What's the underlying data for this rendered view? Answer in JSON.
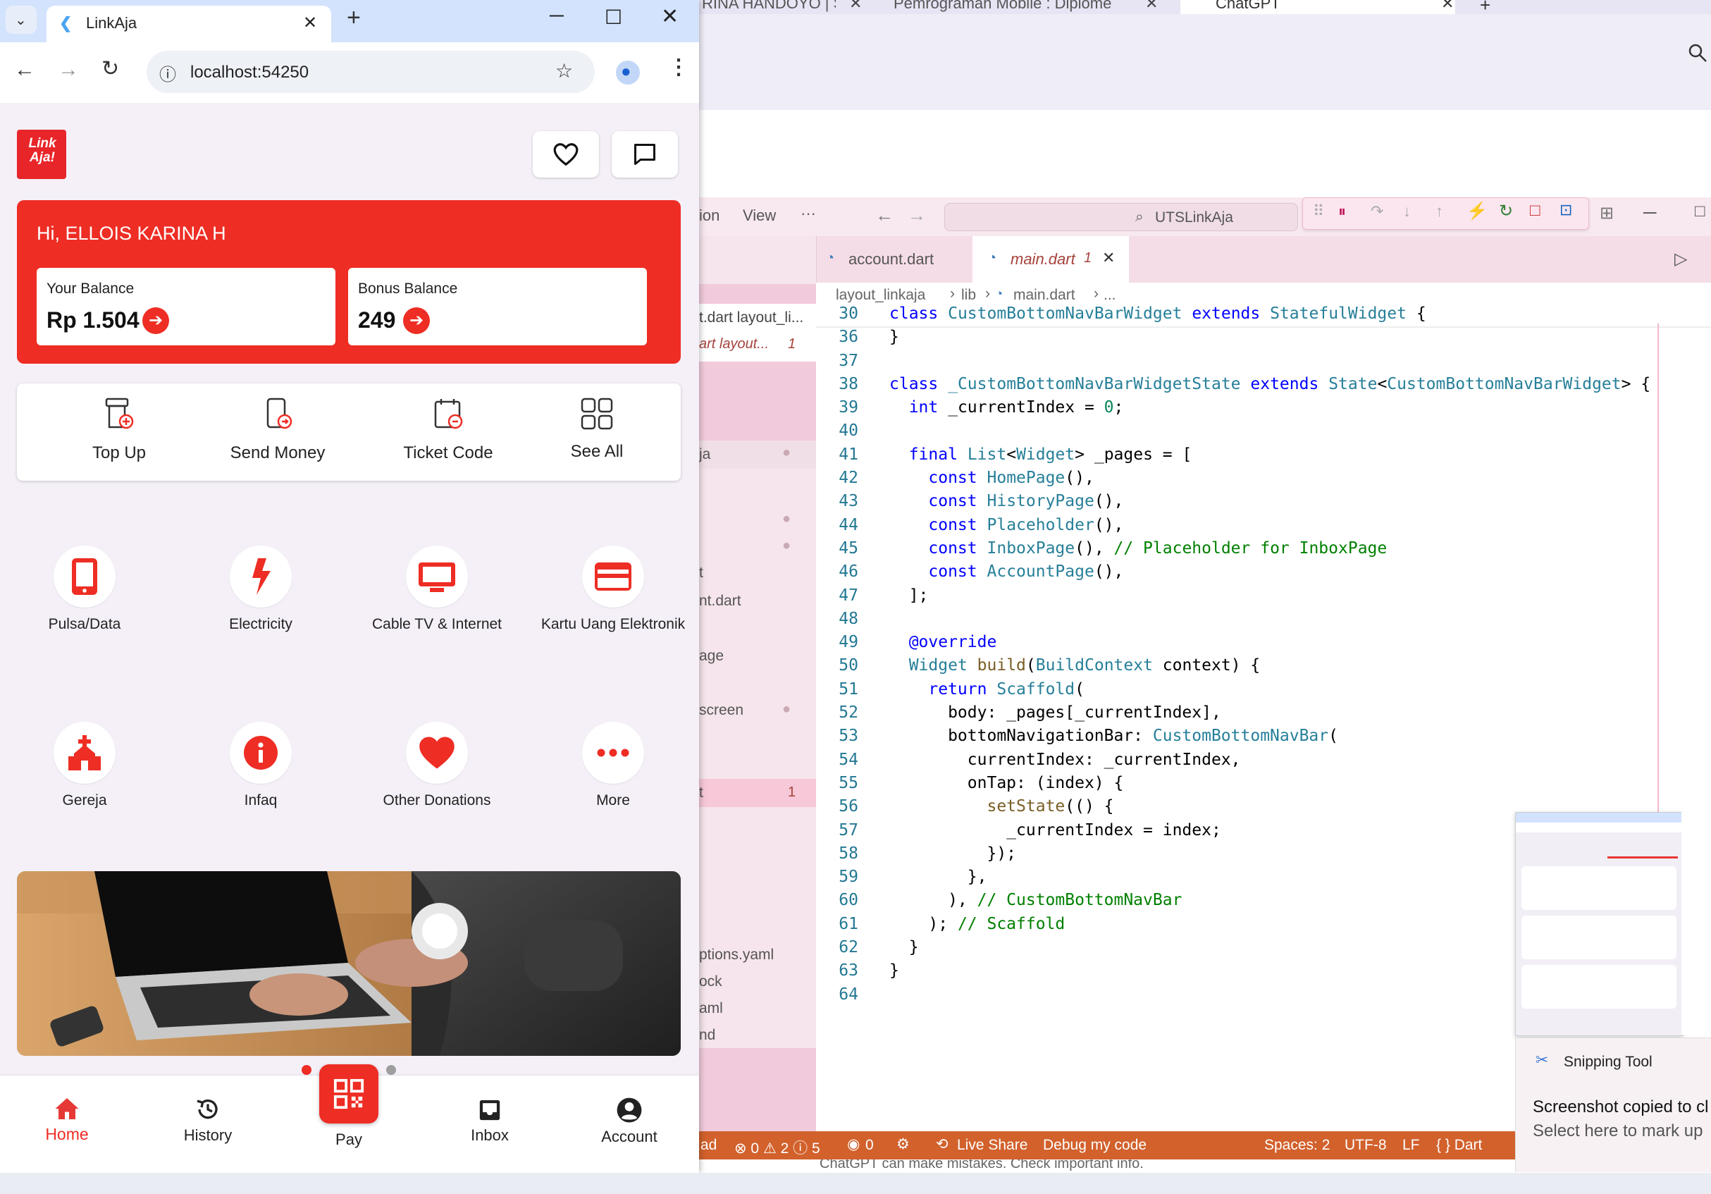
{
  "chrome": {
    "tab_title": "LinkAja",
    "url": "localhost:54250",
    "bg_tabs": [
      "RINA HANDOYO | Sp",
      "Pemrograman Mobile : Diplome",
      "ChatGPT"
    ]
  },
  "app": {
    "logo_text": "Link Aja!",
    "greeting": "Hi, ELLOIS KARINA H",
    "balance": {
      "label": "Your Balance",
      "value": "Rp 1.504"
    },
    "bonus": {
      "label": "Bonus Balance",
      "value": "249"
    },
    "menu": [
      {
        "label": "Top Up",
        "icon": "top-up-icon"
      },
      {
        "label": "Send Money",
        "icon": "send-money-icon"
      },
      {
        "label": "Ticket Code",
        "icon": "ticket-code-icon"
      },
      {
        "label": "See All",
        "icon": "grid-icon"
      }
    ],
    "services": [
      {
        "label": "Pulsa/Data",
        "icon": "phone-icon"
      },
      {
        "label": "Electricity",
        "icon": "bolt-icon"
      },
      {
        "label": "Cable TV & Internet",
        "icon": "tv-icon"
      },
      {
        "label": "Kartu Uang Elektronik",
        "icon": "card-icon"
      },
      {
        "label": "Gereja",
        "icon": "church-icon"
      },
      {
        "label": "Infaq",
        "icon": "info-icon"
      },
      {
        "label": "Other Donations",
        "icon": "heart-icon"
      },
      {
        "label": "More",
        "icon": "more-icon"
      }
    ],
    "nav": [
      {
        "label": "Home",
        "icon": "home-icon"
      },
      {
        "label": "History",
        "icon": "history-icon"
      },
      {
        "label": "Pay",
        "icon": "qr-icon"
      },
      {
        "label": "Inbox",
        "icon": "inbox-icon"
      },
      {
        "label": "Account",
        "icon": "account-icon"
      }
    ],
    "colors": {
      "brand": "#ee2d24",
      "bg": "#f5f0f8"
    }
  },
  "vscode": {
    "menu": [
      "ion",
      "View",
      "···"
    ],
    "search": "UTSLinkAja",
    "tabs": [
      {
        "label": "account.dart"
      },
      {
        "label": "main.dart",
        "badge": "1"
      }
    ],
    "breadcrumb": [
      "layout_linkaja",
      "lib",
      "main.dart",
      "..."
    ],
    "sidebar": [
      {
        "text": "t.dart  layout_li..."
      },
      {
        "text": "art  layout...",
        "badge": "1"
      },
      {
        "text": "ja"
      },
      {
        "text": "t"
      },
      {
        "text": "nt.dart"
      },
      {
        "text": "age"
      },
      {
        "text": "screen"
      },
      {
        "text": "t",
        "badge": "1"
      },
      {
        "text": "ptions.yaml"
      },
      {
        "text": "ock"
      },
      {
        "text": "aml"
      },
      {
        "text": "nd"
      }
    ],
    "code": [
      {
        "n": "30",
        "t": "class CustomBottomNavBarWidget extends StatefulWidget {"
      },
      {
        "n": "36",
        "t": "}"
      },
      {
        "n": "37",
        "t": ""
      },
      {
        "n": "38",
        "t": "class _CustomBottomNavBarWidgetState extends State<CustomBottomNavBarWidget> {"
      },
      {
        "n": "39",
        "t": "  int _currentIndex = 0;"
      },
      {
        "n": "40",
        "t": ""
      },
      {
        "n": "41",
        "t": "  final List<Widget> _pages = ["
      },
      {
        "n": "42",
        "t": "    const HomePage(),"
      },
      {
        "n": "43",
        "t": "    const HistoryPage(),"
      },
      {
        "n": "44",
        "t": "    const Placeholder(),"
      },
      {
        "n": "45",
        "t": "    const InboxPage(), // Placeholder for InboxPage"
      },
      {
        "n": "46",
        "t": "    const AccountPage(),"
      },
      {
        "n": "47",
        "t": "  ];"
      },
      {
        "n": "48",
        "t": ""
      },
      {
        "n": "49",
        "t": "  @override"
      },
      {
        "n": "50",
        "t": "  Widget build(BuildContext context) {"
      },
      {
        "n": "51",
        "t": "    return Scaffold("
      },
      {
        "n": "52",
        "t": "      body: _pages[_currentIndex],"
      },
      {
        "n": "53",
        "t": "      bottomNavigationBar: CustomBottomNavBar("
      },
      {
        "n": "54",
        "t": "        currentIndex: _currentIndex,"
      },
      {
        "n": "55",
        "t": "        onTap: (index) {"
      },
      {
        "n": "56",
        "t": "          setState(() {"
      },
      {
        "n": "57",
        "t": "            _currentIndex = index;"
      },
      {
        "n": "58",
        "t": "          });"
      },
      {
        "n": "59",
        "t": "        },"
      },
      {
        "n": "60",
        "t": "      ), // CustomBottomNavBar"
      },
      {
        "n": "61",
        "t": "    ); // Scaffold"
      },
      {
        "n": "62",
        "t": "  }"
      },
      {
        "n": "63",
        "t": "}"
      },
      {
        "n": "64",
        "t": ""
      }
    ],
    "status": {
      "left": "ad",
      "problems": "⊗ 0 ⚠ 2 ⓘ 5",
      "ports": "0",
      "live_share": "Live Share",
      "debug": "Debug my code",
      "spaces": "Spaces: 2",
      "encoding": "UTF-8",
      "eol": "LF",
      "language": "{ } Dart"
    }
  },
  "chat_footer": "ChatGPT can make mistakes. Check important info.",
  "snipping": {
    "title": "Snipping Tool",
    "message": "Screenshot copied to cl",
    "sub": "Select here to mark up"
  }
}
